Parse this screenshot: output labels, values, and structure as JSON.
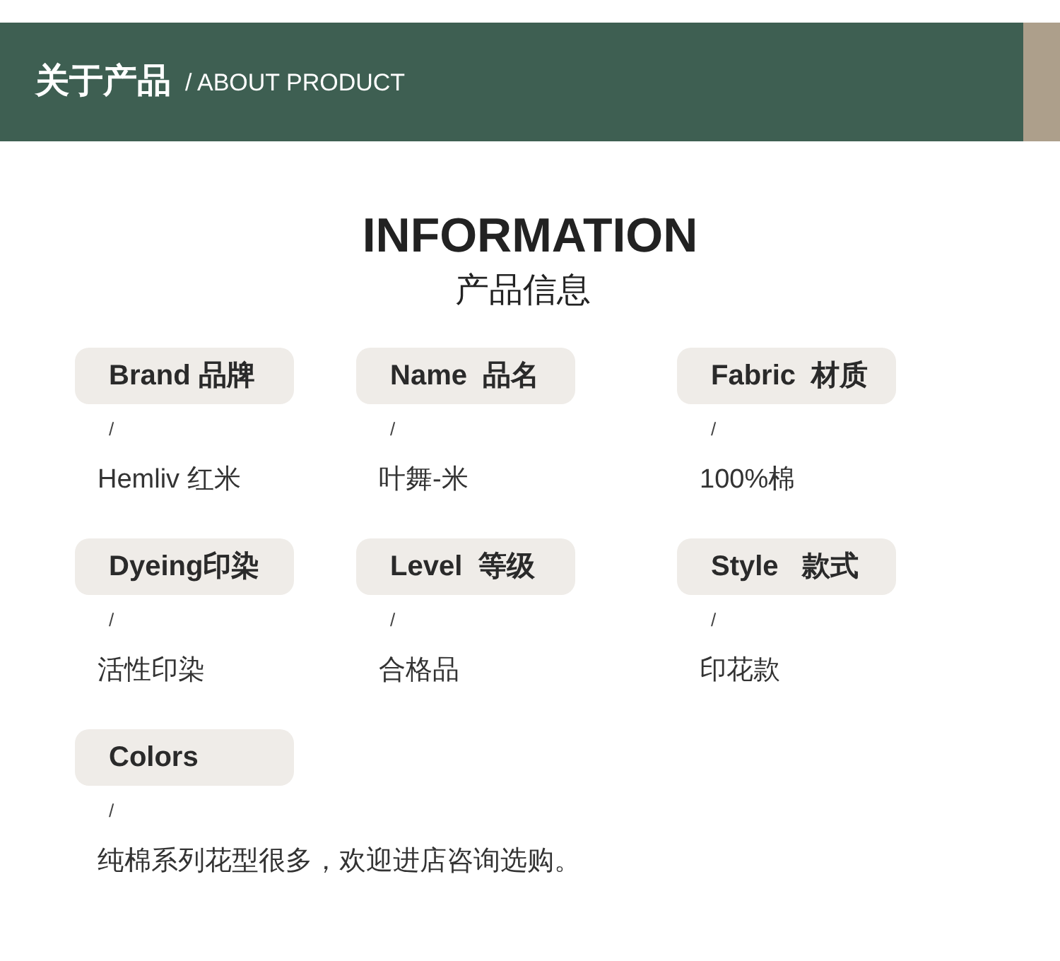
{
  "header": {
    "title": "关于产品",
    "subtitle": "/ ABOUT PRODUCT"
  },
  "heading": {
    "title": "INFORMATION",
    "subtitle": "产品信息"
  },
  "separator": "/",
  "fields": [
    {
      "label": "Brand 品牌",
      "value": "Hemliv 红米"
    },
    {
      "label": "Name  品名",
      "value": "叶舞-米"
    },
    {
      "label": "Fabric  材质",
      "value": "100%棉"
    },
    {
      "label": "Dyeing印染",
      "value": "活性印染"
    },
    {
      "label": "Level  等级",
      "value": "合格品"
    },
    {
      "label": "Style   款式",
      "value": "印花款"
    },
    {
      "label": "Colors",
      "value": "纯棉系列花型很多，欢迎进店咨询选购。"
    }
  ]
}
